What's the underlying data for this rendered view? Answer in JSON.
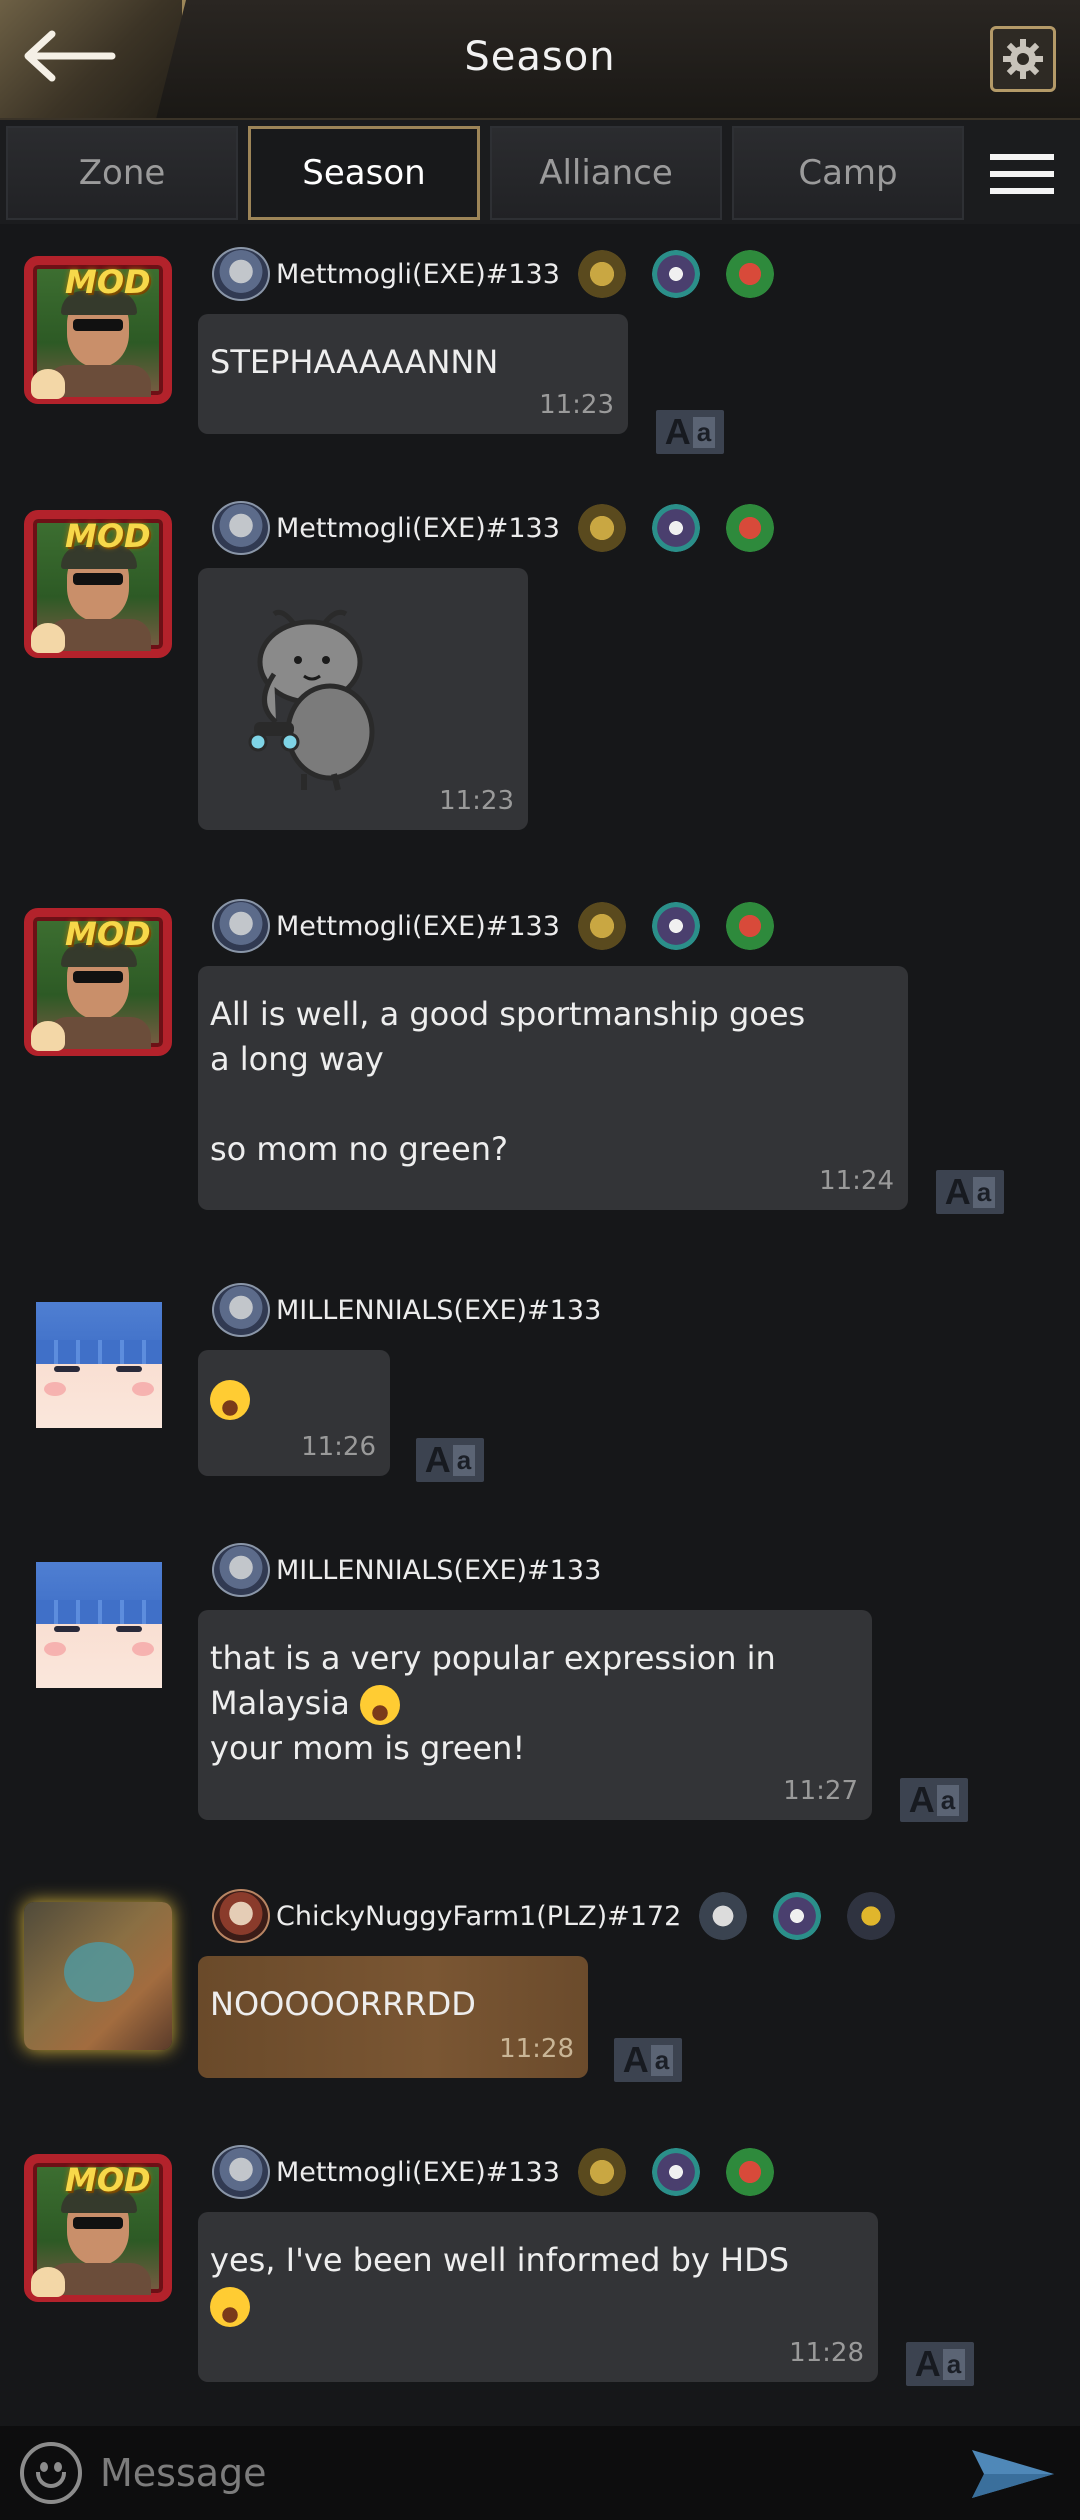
{
  "header": {
    "title": "Season",
    "back_icon": "back-arrow-icon",
    "settings_icon": "gear-icon"
  },
  "tabs": [
    {
      "label": "Zone",
      "active": false
    },
    {
      "label": "Season",
      "active": true
    },
    {
      "label": "Alliance",
      "active": false
    },
    {
      "label": "Camp",
      "active": false
    }
  ],
  "menu_icon": "hamburger-menu-icon",
  "avatar_tag": "MOD",
  "messages": [
    {
      "user": "Mettmogli(EXE)#133",
      "text": "STEPHAAAAANNN",
      "time": "11:23"
    },
    {
      "user": "Mettmogli(EXE)#133",
      "text": "",
      "sticker": "gray-bug-sticker",
      "time": "11:23"
    },
    {
      "user": "Mettmogli(EXE)#133",
      "text": "All is well, a good sportmanship goes\na long way\n\nso mom no green?",
      "time": "11:24"
    },
    {
      "user": "MILLENNIALS(EXE)#133",
      "text": "",
      "emoji": "laughing-tears-emoji",
      "time": "11:26"
    },
    {
      "user": "MILLENNIALS(EXE)#133",
      "text_line1": "that is a very popular expression in",
      "text_line2": "Malaysia",
      "text_line3": "your mom is green!",
      "time": "11:27"
    },
    {
      "user": "ChickyNuggyFarm1(PLZ)#172",
      "text": "NOOOOORRRDD",
      "time": "11:28"
    },
    {
      "user": "Mettmogli(EXE)#133",
      "text": "yes, I've been well informed by HDS",
      "time": "11:28"
    }
  ],
  "translate_label": {
    "big": "A",
    "small": "a"
  },
  "input": {
    "placeholder": "Message",
    "value": ""
  },
  "colors": {
    "accent_gold": "#9d8558",
    "bubble": "#333437",
    "background": "#161719"
  }
}
